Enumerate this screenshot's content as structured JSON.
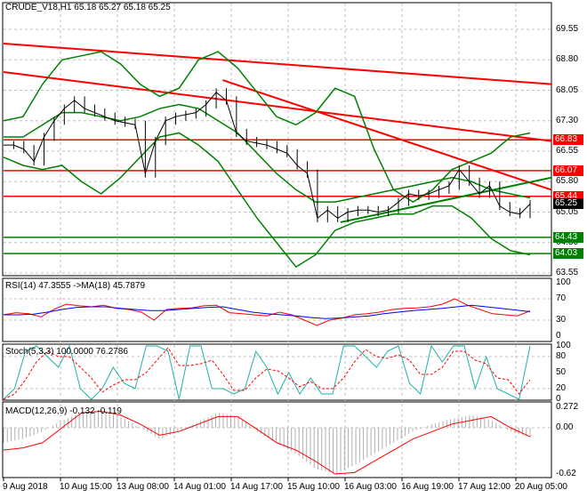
{
  "header": {
    "title": "CRUDE_V18,H1  65.18 65.27 65.18 65.25"
  },
  "price_axis": [
    "69.55",
    "68.80",
    "68.05",
    "67.30",
    "66.55",
    "65.80",
    "65.05",
    "64.30",
    "63.55"
  ],
  "price_axis_values": [
    69.55,
    68.8,
    68.05,
    67.3,
    66.55,
    65.8,
    65.05,
    64.3,
    63.55
  ],
  "level_tags": [
    {
      "label": "66.83",
      "value": 66.83,
      "color": "#ff0000"
    },
    {
      "label": "66.07",
      "value": 66.07,
      "color": "#ff0000"
    },
    {
      "label": "65.44",
      "value": 65.44,
      "color": "#ff0000"
    },
    {
      "label": "65.25",
      "value": 65.25,
      "color": "#000000"
    },
    {
      "label": "64.43",
      "value": 64.43,
      "color": "#008000"
    },
    {
      "label": "64.03",
      "value": 64.03,
      "color": "#008000"
    }
  ],
  "rsi": {
    "label": "RSI(14) 47.3555  ->MA(18) 45.7879",
    "axis": [
      "100",
      "70",
      "30",
      "0"
    ]
  },
  "stoch": {
    "label": "Stoch(5,3,3) 100.0000 76.2786",
    "axis": [
      "100",
      "80",
      "50",
      "20",
      "0"
    ]
  },
  "macd": {
    "label": "MACD(12,26,9) -0.132 -0.119",
    "axis": [
      "0.272",
      "0.00",
      "-0.62"
    ]
  },
  "dates": [
    "9 Aug 2018",
    "10 Aug 15:00",
    "13 Aug 08:00",
    "14 Aug 01:00",
    "14 Aug 17:00",
    "15 Aug 10:00",
    "16 Aug 03:00",
    "16 Aug 19:00",
    "17 Aug 12:00",
    "20 Aug 05:00"
  ],
  "colors": {
    "up": "#008000",
    "down": "#ff0000",
    "rsi": "#ff0000",
    "rsi_ma": "#0000ff",
    "stoch_k": "#20b2aa",
    "stoch_d": "#ff0000",
    "macd_hist": "#b0b0b0",
    "macd_signal": "#ff0000"
  },
  "chart_data": {
    "type": "line",
    "symbol": "CRUDE_V18",
    "timeframe": "H1",
    "close": [
      66.7,
      66.7,
      66.6,
      66.3,
      66.9,
      67.3,
      67.6,
      67.8,
      67.6,
      67.5,
      67.4,
      67.3,
      67.25,
      67.2,
      66.0,
      66.8,
      67.3,
      67.4,
      67.45,
      67.5,
      67.7,
      68.0,
      67.8,
      67.0,
      66.8,
      66.75,
      66.7,
      66.6,
      66.5,
      66.2,
      66.0,
      64.9,
      65.1,
      64.9,
      65.05,
      65.1,
      65.1,
      65.05,
      65.1,
      65.3,
      65.5,
      65.45,
      65.5,
      65.6,
      65.7,
      66.1,
      65.8,
      65.5,
      65.7,
      65.2,
      65.05,
      65.0,
      65.25
    ],
    "bb_upper": [
      67.3,
      67.4,
      68.2,
      68.8,
      68.9,
      69.0,
      68.7,
      68.2,
      67.9,
      68.1,
      68.8,
      69.0,
      68.6,
      68.0,
      67.4,
      67.2,
      67.5,
      68.1,
      67.9,
      66.6,
      65.6,
      65.3,
      65.6,
      66.1,
      66.3,
      66.5,
      66.9,
      67.0
    ],
    "bb_middle": [
      66.9,
      66.9,
      67.2,
      67.5,
      67.5,
      67.4,
      67.3,
      67.4,
      67.6,
      67.7,
      67.6,
      67.3,
      67.0,
      66.5,
      66.0,
      65.6,
      65.3,
      65.3,
      65.4,
      65.5,
      65.6,
      65.7,
      65.8,
      65.9,
      65.8,
      65.6,
      65.5,
      65.4
    ],
    "bb_lower": [
      66.4,
      66.2,
      66.1,
      66.2,
      65.8,
      65.5,
      65.9,
      66.4,
      66.9,
      67.0,
      66.7,
      66.3,
      65.6,
      64.9,
      64.3,
      63.7,
      64.0,
      64.6,
      64.8,
      64.9,
      65.0,
      65.0,
      65.2,
      65.2,
      64.9,
      64.4,
      64.1,
      64.0
    ],
    "trendlines": [
      {
        "color": "#ff0000",
        "from": [
          0,
          69.2
        ],
        "to": [
          1,
          68.2
        ]
      },
      {
        "color": "#ff0000",
        "from": [
          0,
          68.5
        ],
        "to": [
          1,
          66.8
        ]
      },
      {
        "color": "#ff0000",
        "from": [
          0.4,
          68.3
        ],
        "to": [
          1,
          65.6
        ]
      },
      {
        "color": "#008000",
        "from": [
          0.615,
          64.8
        ],
        "to": [
          1,
          65.9
        ]
      }
    ],
    "hlines": [
      {
        "value": 66.83,
        "color": "#ff0000"
      },
      {
        "value": 66.07,
        "color": "#ff0000"
      },
      {
        "value": 65.44,
        "color": "#ff0000"
      },
      {
        "value": 64.43,
        "color": "#008000"
      },
      {
        "value": 64.03,
        "color": "#008000"
      }
    ],
    "rsi": [
      40,
      44,
      42,
      36,
      50,
      60,
      57,
      55,
      58,
      52,
      50,
      45,
      30,
      50,
      52,
      53,
      57,
      58,
      44,
      42,
      40,
      38,
      45,
      40,
      30,
      20,
      30,
      34,
      40,
      42,
      45,
      50,
      52,
      53,
      55,
      60,
      70,
      58,
      50,
      42,
      40,
      38,
      47.36
    ],
    "rsi_ma": [
      40,
      40,
      41,
      45,
      50,
      54,
      55,
      55,
      52,
      50,
      48,
      48,
      50,
      52,
      54,
      55,
      50,
      45,
      42,
      40,
      38,
      35,
      33,
      34,
      36,
      38,
      42,
      45,
      48,
      50,
      52,
      55,
      58,
      55,
      52,
      49,
      45.79
    ],
    "stoch_k": [
      0,
      20,
      90,
      100,
      80,
      60,
      100,
      20,
      0,
      20,
      60,
      30,
      20,
      100,
      100,
      90,
      0,
      100,
      100,
      20,
      20,
      10,
      20,
      90,
      60,
      10,
      50,
      10,
      40,
      10,
      10,
      100,
      100,
      80,
      60,
      90,
      100,
      30,
      10,
      100,
      70,
      100,
      100,
      20,
      80,
      20,
      10,
      0,
      100
    ],
    "macd_hist": [
      -0.2,
      -0.15,
      -0.05,
      0.1,
      0.2,
      0.22,
      0.15,
      0.0,
      -0.15,
      -0.05,
      0.08,
      0.2,
      0.15,
      -0.05,
      -0.2,
      -0.35,
      -0.55,
      -0.62,
      -0.5,
      -0.35,
      -0.2,
      -0.05,
      0.05,
      0.12,
      0.17,
      0.1,
      -0.05,
      -0.13
    ],
    "macd_signal": [
      -0.3,
      -0.27,
      -0.2,
      0.0,
      0.2,
      0.22,
      0.17,
      0.05,
      -0.1,
      -0.05,
      0.05,
      0.15,
      0.15,
      -0.02,
      -0.2,
      -0.3,
      -0.45,
      -0.62,
      -0.6,
      -0.45,
      -0.3,
      -0.15,
      -0.05,
      0.05,
      0.1,
      0.15,
      0.0,
      -0.12
    ]
  }
}
